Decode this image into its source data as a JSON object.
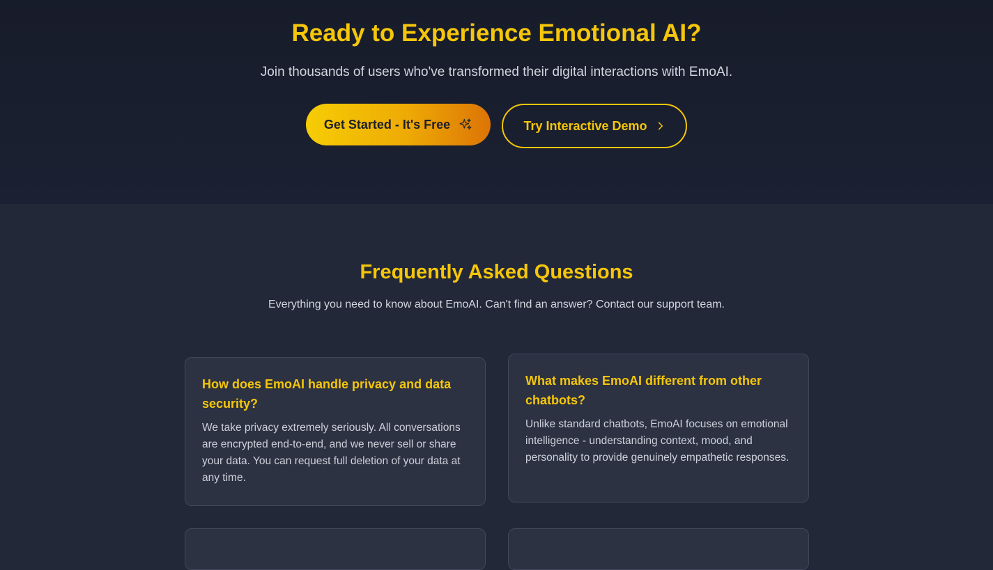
{
  "cta": {
    "title": "Ready to Experience Emotional AI?",
    "subtitle": "Join thousands of users who've transformed their digital interactions with EmoAI.",
    "primary_button": {
      "label": "Get Started - It's Free",
      "icon": "sparkles-icon"
    },
    "secondary_button": {
      "label": "Try Interactive Demo",
      "icon": "chevron-right-icon"
    }
  },
  "faq": {
    "title": "Frequently Asked Questions",
    "subtitle": "Everything you need to know about EmoAI. Can't find an answer? Contact our support team.",
    "items": [
      {
        "question": "How does EmoAI handle privacy and data security?",
        "answer": "We take privacy extremely seriously. All conversations are encrypted end-to-end, and we never sell or share your data. You can request full deletion of your data at any time."
      },
      {
        "question": "What makes EmoAI different from other chatbots?",
        "answer": "Unlike standard chatbots, EmoAI focuses on emotional intelligence - understanding context, mood, and personality to provide genuinely empathetic responses."
      }
    ]
  },
  "colors": {
    "accent": "#f5c60a",
    "gradient_start": "#f6cd05",
    "gradient_end": "#dc7406",
    "background": "#222838",
    "card_background": "#2c3242"
  }
}
